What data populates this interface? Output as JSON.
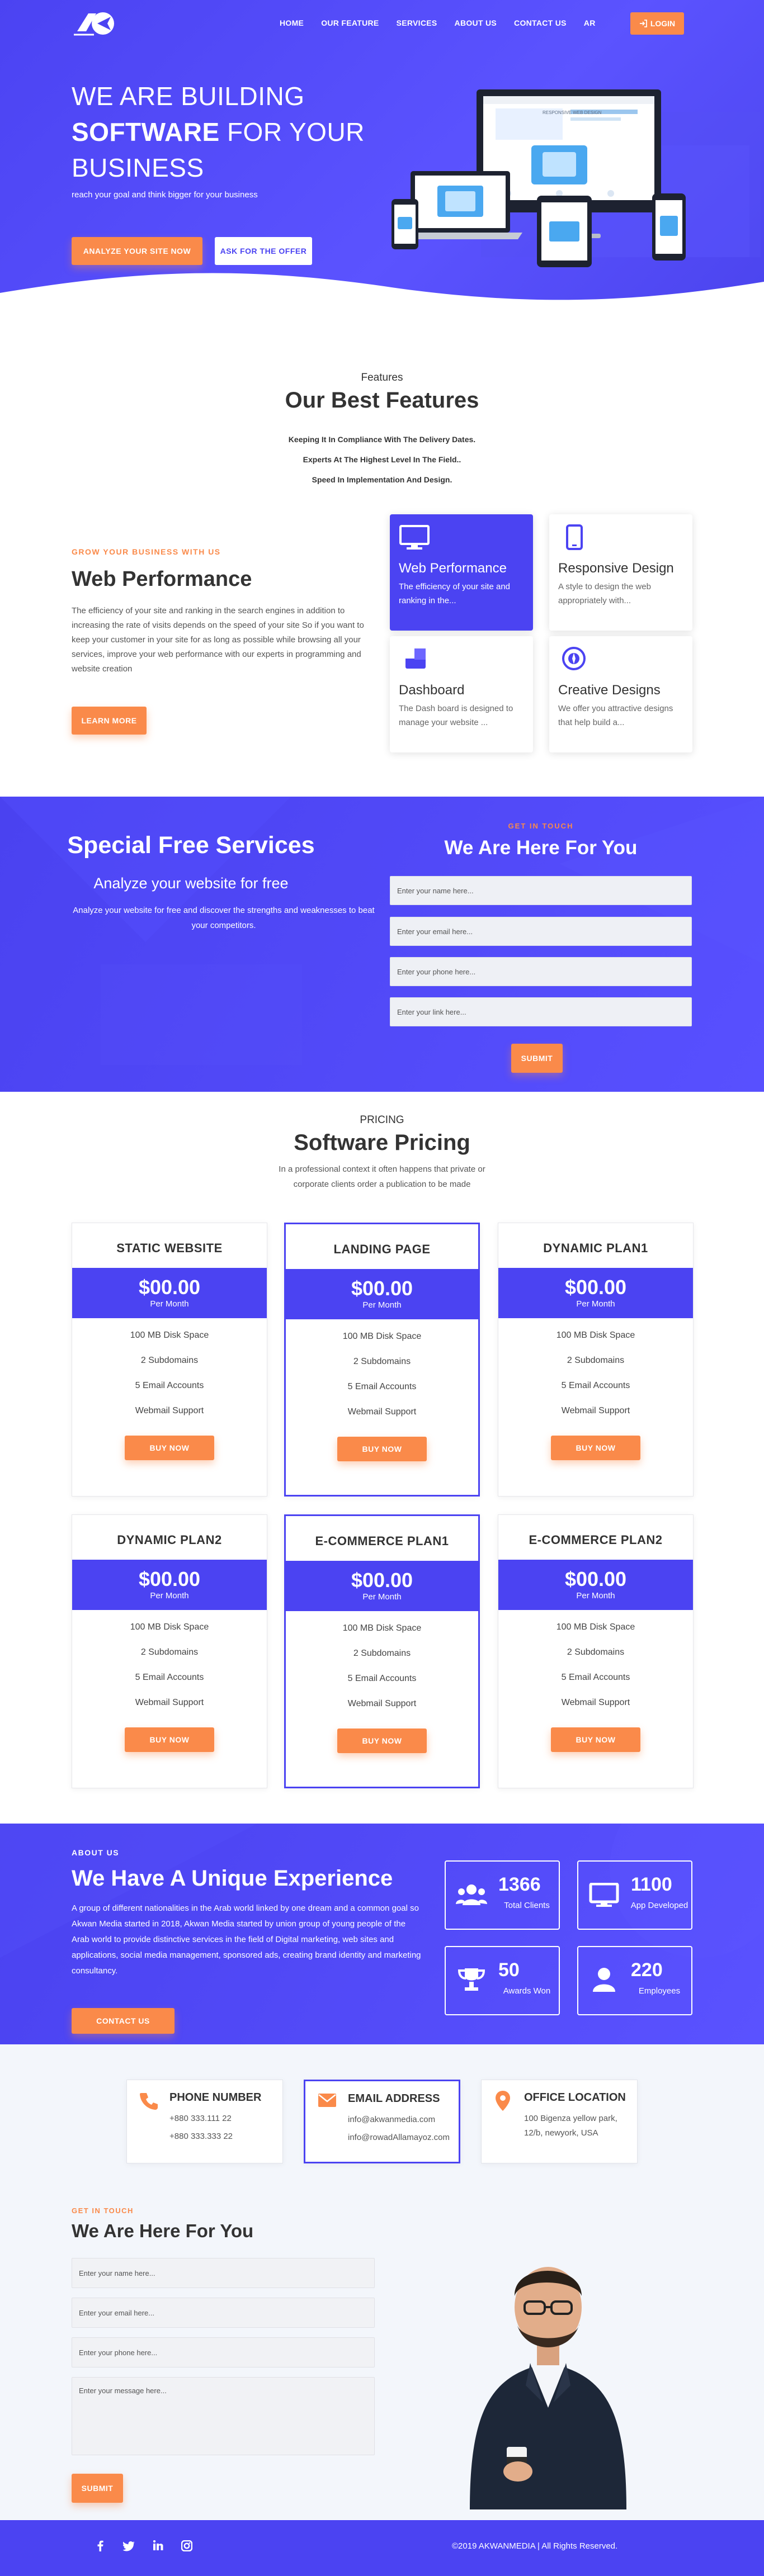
{
  "nav": {
    "items": [
      "HOME",
      "OUR FEATURE",
      "SERVICES",
      "ABOUT US",
      "CONTACT US",
      "AR"
    ],
    "login": "LOGIN"
  },
  "hero": {
    "line1": "WE ARE BUILDING",
    "line2_bold": "SOFTWARE",
    "line2_rest": " FOR YOUR",
    "line3": "BUSINESS",
    "subtitle": "reach your goal and think bigger for your business",
    "btn_analyze": "ANALYZE YOUR SITE NOW",
    "btn_offer": "ASK FOR THE OFFER",
    "screen_title": "RESPONSIVE WEB DESIGN"
  },
  "features": {
    "kicker": "Features",
    "title": "Our Best Features",
    "points": [
      "Keeping It In Compliance With The Delivery Dates.",
      "Experts At The Highest Level In The Field..",
      "Speed In Implementation And Design."
    ],
    "grow": "GROW YOUR BUSINESS WITH US",
    "heading": "Web Performance",
    "body": "The efficiency of your site and ranking in the search engines in addition to increasing the rate of visits depends on the speed of your site So if you want to keep your customer in your site for as long as possible while browsing all your services, improve your web performance with our experts in programming and website creation",
    "learn": "LEARN MORE",
    "cards": [
      {
        "title": "Web Performance",
        "text": "The efficiency of your site and ranking in the..."
      },
      {
        "title": "Responsive Design",
        "text": "A style to design the web appropriately with..."
      },
      {
        "title": "Dashboard",
        "text": "The Dash board is designed to manage your website ..."
      },
      {
        "title": "Creative Designs",
        "text": "We offer you attractive designs that help build a..."
      }
    ]
  },
  "services": {
    "title": "Special Free Services",
    "subtitle": "Analyze your website for free",
    "text": "Analyze your website for free and discover the strengths and weaknesses to beat your competitors.",
    "kicker": "GET IN TOUCH",
    "form_title": "We Are Here For You",
    "ph_name": "Enter your name here...",
    "ph_email": "Enter your email here...",
    "ph_phone": "Enter your phone here...",
    "ph_link": "Enter your link here...",
    "submit": "SUBMIT"
  },
  "pricing": {
    "kicker": "PRICING",
    "title": "Software Pricing",
    "desc1": "In a professional context it often happens that private or",
    "desc2": "corporate clients order a publication to be made",
    "per": "Per Month",
    "buy": "BUY NOW",
    "features": [
      "100 MB Disk Space",
      "2 Subdomains",
      "5 Email Accounts",
      "Webmail Support"
    ],
    "plans": [
      {
        "name": "STATIC WEBSITE",
        "price": "$00.00"
      },
      {
        "name": "LANDING PAGE",
        "price": "$00.00"
      },
      {
        "name": "DYNAMIC PLAN1",
        "price": "$00.00"
      },
      {
        "name": "DYNAMIC PLAN2",
        "price": "$00.00"
      },
      {
        "name": "E-COMMERCE PLAN1",
        "price": "$00.00"
      },
      {
        "name": "E-COMMERCE PLAN2",
        "price": "$00.00"
      }
    ]
  },
  "about": {
    "kicker": "ABOUT US",
    "title": "We Have A Unique Experience",
    "text": "A group of different nationalities in the Arab world linked by one dream and a common goal so Akwan Media started in 2018, Akwan Media started by union group of young people of the Arab world to provide distinctive   services in the field of Digital marketing, web sites and applications, social media management, sponsored ads, creating brand identity and marketing consultancy.",
    "btn": "CONTACT US",
    "stats": [
      {
        "num": "1366",
        "label": "Total Clients"
      },
      {
        "num": "1100",
        "label": "App Developed"
      },
      {
        "num": "50",
        "label": "Awards Won"
      },
      {
        "num": "220",
        "label": "Employees"
      }
    ]
  },
  "contact": {
    "phone_title": "PHONE NUMBER",
    "phone1": "+880 333.111 22",
    "phone2": "+880 333.333 22",
    "email_title": "EMAIL ADDRESS",
    "email1": "info@akwanmedia.com",
    "email2": "info@rowadAllamayoz.com",
    "office_title": "OFFICE LOCATION",
    "office1": "100 Bigenza yellow park,",
    "office2": "12/b, newyork, USA",
    "kicker": "GET IN TOUCH",
    "title": "We Are Here For You",
    "ph_name": "Enter your name here...",
    "ph_email": "Enter your email here...",
    "ph_phone": "Enter your phone here...",
    "ph_msg": "Enter your message here...",
    "submit": "SUBMIT"
  },
  "footer": {
    "copyright": "©2019 AKWANMEDIA | All Rights Reserved."
  },
  "colors": {
    "primary": "#4b43f2",
    "accent": "#fa8a4a"
  }
}
